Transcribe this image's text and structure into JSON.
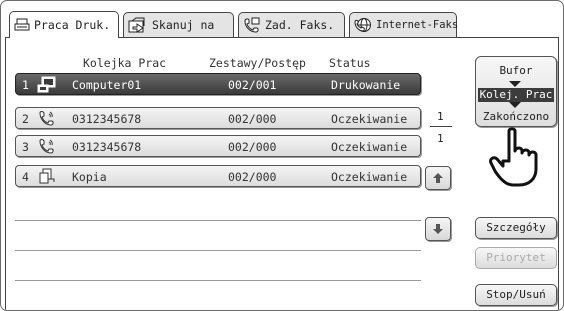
{
  "tabs": [
    {
      "label": "Praca Druk.",
      "icon": "printer-icon",
      "active": true
    },
    {
      "label": "Skanuj na",
      "icon": "scan-icon",
      "active": false
    },
    {
      "label": "Zad. Faks.",
      "icon": "fax-icon",
      "active": false
    },
    {
      "label": "Internet-Faks",
      "icon": "internet-fax-icon",
      "active": false
    }
  ],
  "columns": {
    "queue": "Kolejka Prac",
    "progress": "Zestawy/Postęp",
    "status": "Status"
  },
  "jobs": [
    {
      "num": "1",
      "icon": "computer-icon",
      "name": "Computer01",
      "progress": "002/001",
      "status": "Drukowanie",
      "selected": true
    },
    {
      "num": "2",
      "icon": "phone-icon",
      "name": "0312345678",
      "progress": "002/000",
      "status": "Oczekiwanie",
      "selected": false
    },
    {
      "num": "3",
      "icon": "phone-icon",
      "name": "0312345678",
      "progress": "002/000",
      "status": "Oczekiwanie",
      "selected": false
    },
    {
      "num": "4",
      "icon": "copy-icon",
      "name": "Kopia",
      "progress": "002/000",
      "status": "Oczekiwanie",
      "selected": false
    }
  ],
  "pagination": {
    "current": "1",
    "total": "1"
  },
  "mode_selector": {
    "items": [
      "Bufor",
      "Kolej. Prac",
      "Zakończono"
    ],
    "active_index": 1
  },
  "buttons": {
    "details": "Szczegóły",
    "priority": "Priorytet",
    "stop_delete": "Stop/Usuń"
  },
  "colors": {
    "selected_row": "#4a4a4a",
    "disabled_text": "#aaaaaa"
  }
}
